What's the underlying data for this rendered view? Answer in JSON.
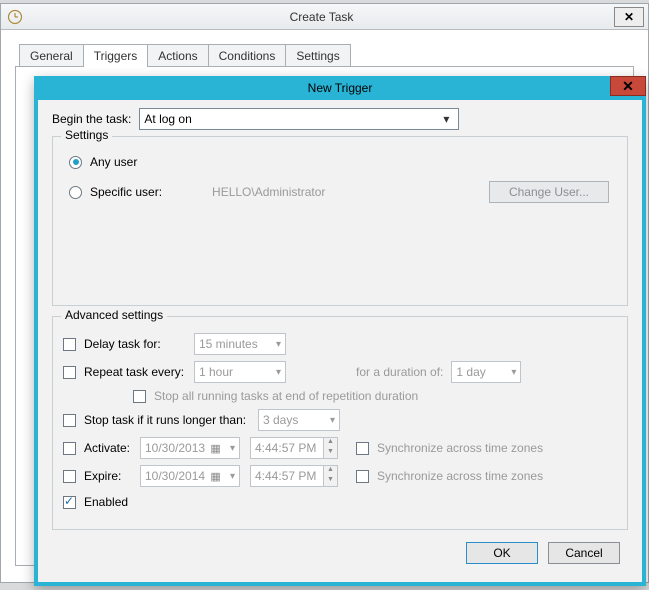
{
  "outer": {
    "title": "Create Task",
    "tabs": [
      "General",
      "Triggers",
      "Actions",
      "Conditions",
      "Settings"
    ],
    "active_tab": "Triggers"
  },
  "dialog": {
    "title": "New Trigger",
    "begin_label": "Begin the task:",
    "begin_value": "At log on",
    "settings": {
      "legend": "Settings",
      "any_user": "Any user",
      "specific_user": "Specific user:",
      "user_value": "HELLO\\Administrator",
      "change_user": "Change User..."
    },
    "advanced": {
      "legend": "Advanced settings",
      "delay_label": "Delay task for:",
      "delay_value": "15 minutes",
      "repeat_label": "Repeat task every:",
      "repeat_value": "1 hour",
      "duration_label": "for a duration of:",
      "duration_value": "1 day",
      "stop_all": "Stop all running tasks at end of repetition duration",
      "stop_if_label": "Stop task if it runs longer than:",
      "stop_if_value": "3 days",
      "activate_label": "Activate:",
      "activate_date": "10/30/2013",
      "activate_time": "4:44:57 PM",
      "expire_label": "Expire:",
      "expire_date": "10/30/2014",
      "expire_time": "4:44:57 PM",
      "sync_tz": "Synchronize across time zones",
      "enabled_label": "Enabled"
    },
    "buttons": {
      "ok": "OK",
      "cancel": "Cancel"
    }
  }
}
